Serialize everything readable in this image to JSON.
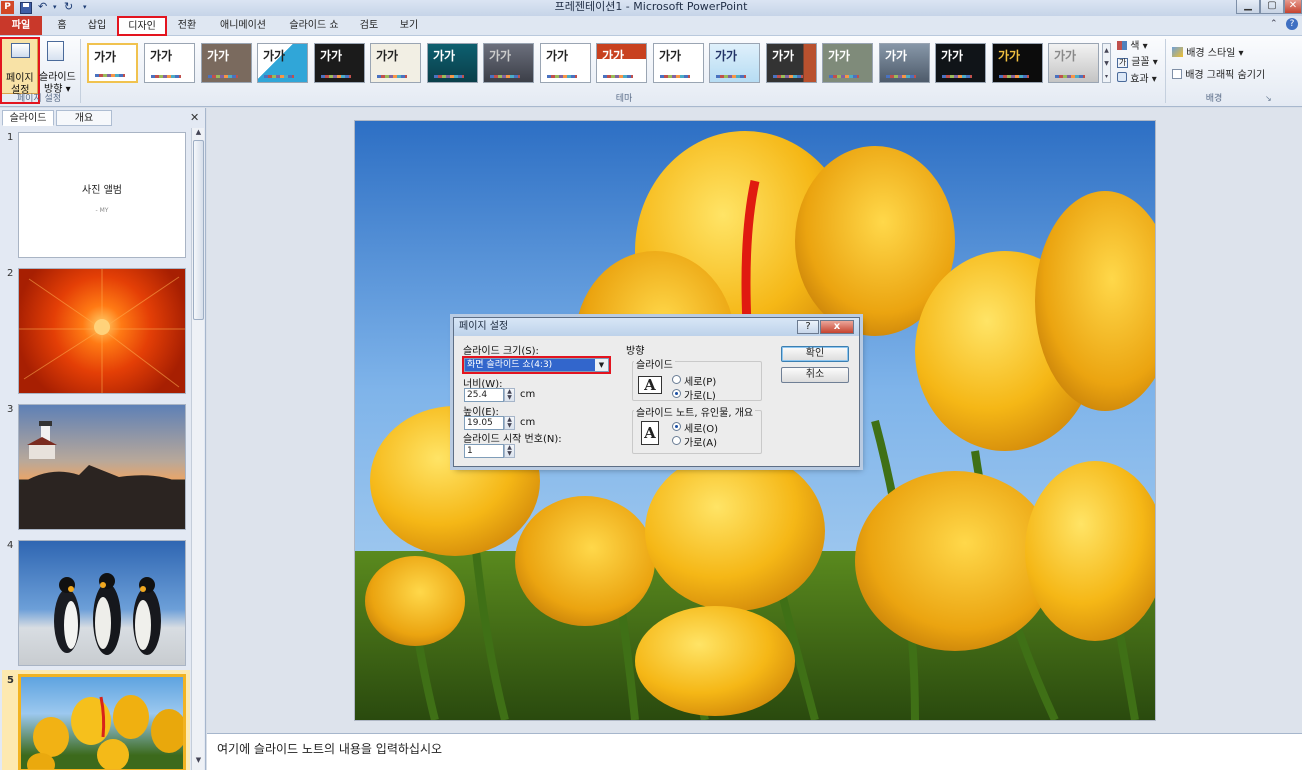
{
  "app": {
    "title": "프레젠테이션1 - Microsoft PowerPoint",
    "ppt_icon": "P"
  },
  "tabs": {
    "file": "파일",
    "home": "홈",
    "insert": "삽입",
    "design": "디자인",
    "transitions": "전환",
    "animations": "애니메이션",
    "slideshow": "슬라이드 쇼",
    "review": "검토",
    "view": "보기"
  },
  "ribbon": {
    "page_setup_label": "페이지\n설정",
    "page_setup_l1": "페이지",
    "page_setup_l2": "설정",
    "orientation_l1": "슬라이드",
    "orientation_l2": "방향 ▾",
    "group_page_setup": "페이지 설정",
    "group_theme": "테마",
    "group_background": "배경",
    "theme_sample": "가가",
    "colors": "색 ▾",
    "fonts": "글꼴 ▾",
    "effects": "효과 ▾",
    "bg_styles": "배경 스타일 ▾",
    "hide_bg_graphics": "배경 그래픽 숨기기"
  },
  "leftpane": {
    "tab_slides": "슬라이드",
    "tab_outline": "개요",
    "slides": [
      {
        "num": "1",
        "title": "사진 앨범",
        "subtitle": "- MY"
      },
      {
        "num": "2"
      },
      {
        "num": "3"
      },
      {
        "num": "4"
      },
      {
        "num": "5"
      }
    ]
  },
  "notes": {
    "placeholder": "여기에 슬라이드 노트의 내용을 입력하십시오"
  },
  "dialog": {
    "title": "페이지 설정",
    "help": "?",
    "close": "x",
    "size_label": "슬라이드 크기(S):",
    "size_value": "화면 슬라이드 쇼(4:3)",
    "width_label": "너비(W):",
    "width_value": "25.4",
    "height_label": "높이(E):",
    "height_value": "19.05",
    "unit": "cm",
    "start_label": "슬라이드 시작 번호(N):",
    "start_value": "1",
    "orientation_label": "방향",
    "slides_group": "슬라이드",
    "portrait": "세로(P)",
    "landscape": "가로(L)",
    "notes_group": "슬라이드 노트, 유인물, 개요",
    "notes_portrait": "세로(O)",
    "notes_landscape": "가로(A)",
    "ok": "확인",
    "cancel": "취소"
  },
  "colors": {
    "file_tab": "#c9382a",
    "highlight": "#e3141f",
    "selected_thumb": "#f2b321"
  }
}
